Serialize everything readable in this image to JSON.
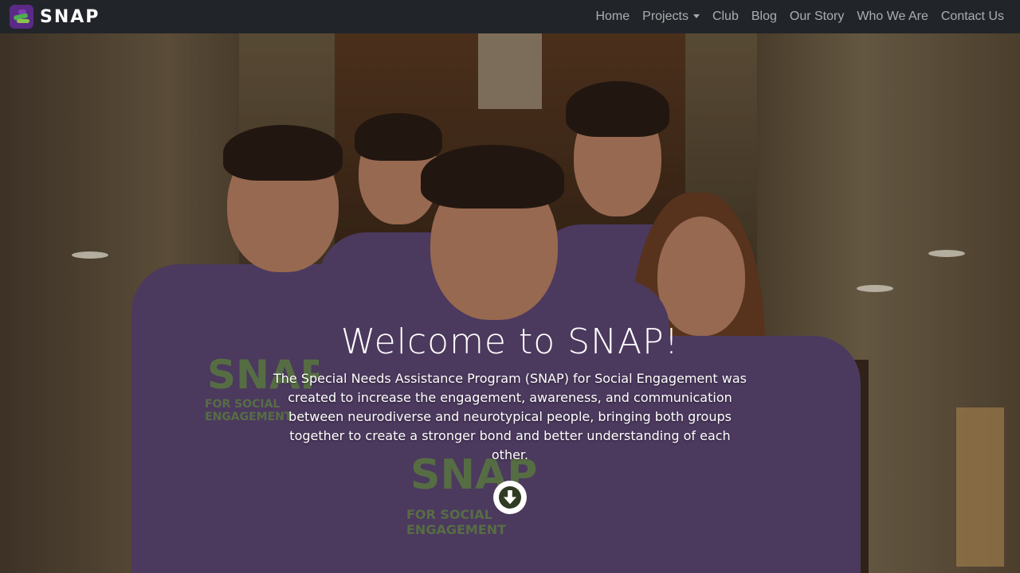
{
  "brand": {
    "name": "SNAP",
    "logo_icon": "snap-logo-icon"
  },
  "nav": {
    "items": [
      {
        "label": "Home"
      },
      {
        "label": "Projects",
        "has_dropdown": true
      },
      {
        "label": "Club"
      },
      {
        "label": "Blog"
      },
      {
        "label": "Our Story"
      },
      {
        "label": "Who We Are"
      },
      {
        "label": "Contact Us"
      }
    ]
  },
  "hero": {
    "title": "Welcome to SNAP!",
    "description": "The Special Needs Assistance Program (SNAP) for Social Engagement was created to increase the engagement, awareness, and communication between neurodiverse and neurotypical people, bringing both groups together to create a stronger bond and better understanding of each other.",
    "scroll_icon": "arrow-down-circle-icon",
    "shirt_print_1": "SNAP",
    "shirt_print_2": "FOR SOCIAL ENGAGEMENT"
  },
  "colors": {
    "navbar_bg": "#212529",
    "nav_text": "rgba(255,255,255,0.62)",
    "brand_purple": "#5b2a86",
    "shirt_purple": "#5d4673",
    "print_green": "#6f9a4a"
  }
}
